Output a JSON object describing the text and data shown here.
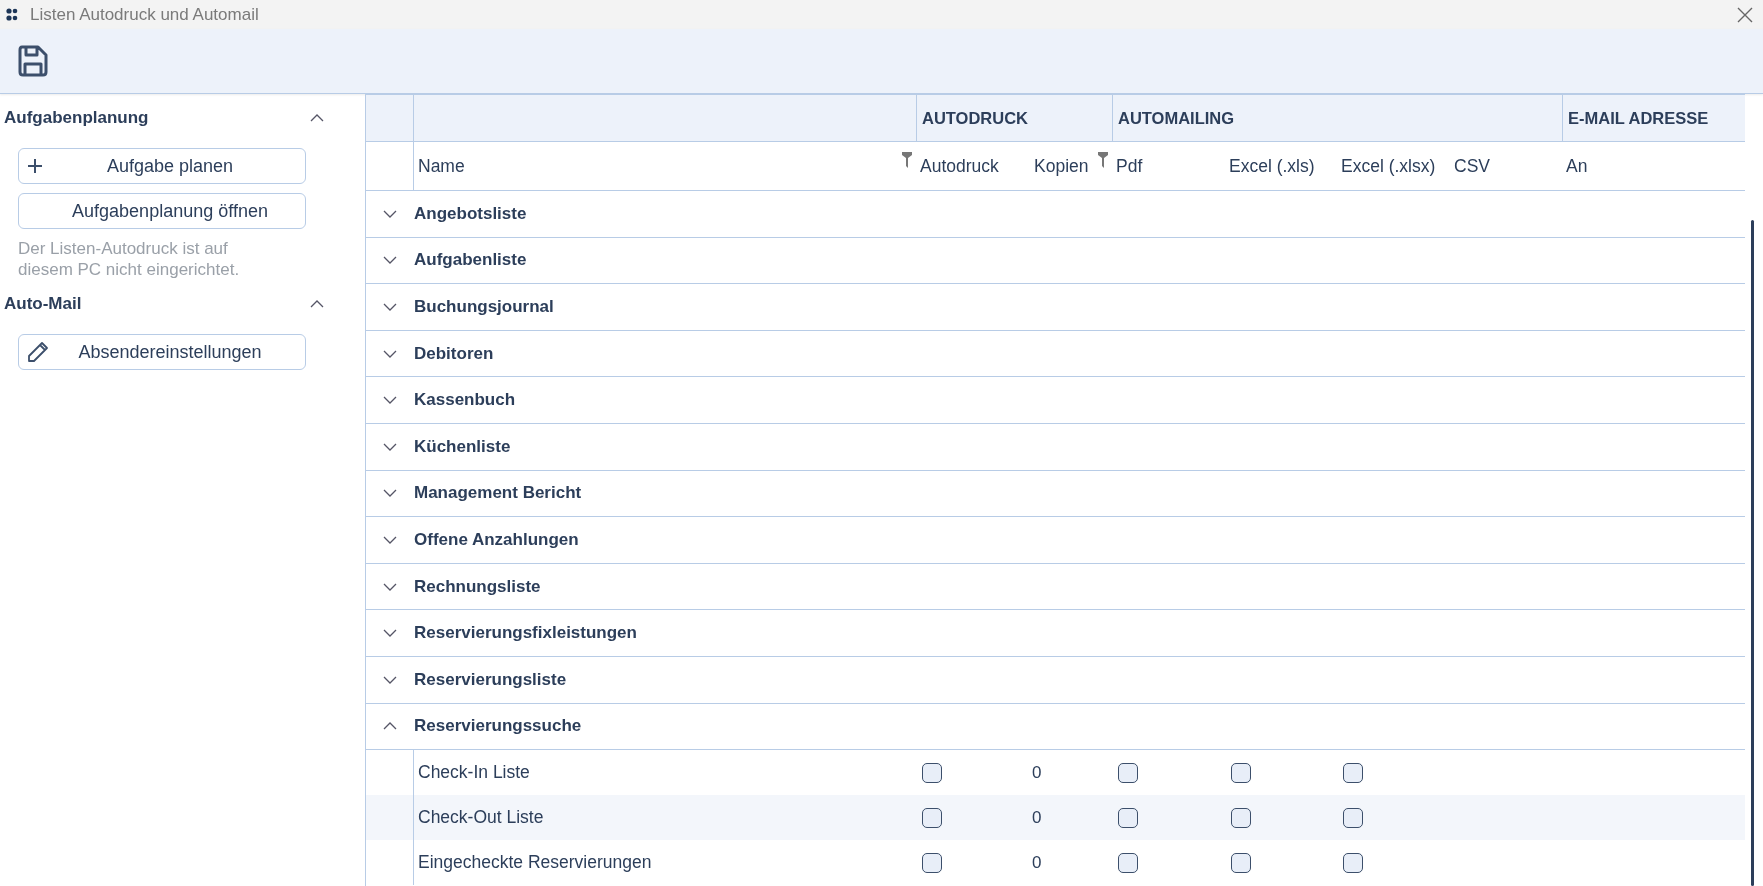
{
  "window": {
    "title": "Listen Autodruck und Automail"
  },
  "sidebar": {
    "sections": [
      {
        "title": "Aufgabenplanung",
        "expanded": true,
        "buttons": [
          {
            "label": "Aufgabe planen",
            "kind": "plus"
          },
          {
            "label": "Aufgabenplanung öffnen",
            "kind": "plain"
          }
        ],
        "note": "Der Listen-Autodruck ist auf diesem PC nicht eingerichtet."
      },
      {
        "title": "Auto-Mail",
        "expanded": true,
        "buttons": [
          {
            "label": "Absendereinstellungen",
            "kind": "pencil"
          }
        ]
      }
    ]
  },
  "table": {
    "column_groups": [
      {
        "columns": [
          {
            "label": "Name",
            "filter": true
          }
        ]
      },
      {
        "label": "AUTODRUCK",
        "columns": [
          {
            "label": "Autodruck",
            "filter": false
          },
          {
            "label": "Kopien",
            "filter": true
          }
        ]
      },
      {
        "label": "AUTOMAILING",
        "columns": [
          {
            "label": "Pdf",
            "filter": false
          },
          {
            "label": "Excel (.xls)",
            "filter": false
          },
          {
            "label": "Excel (.xlsx)",
            "filter": false
          },
          {
            "label": "CSV",
            "filter": false
          }
        ]
      },
      {
        "label": "E-MAIL ADRESSE",
        "columns": [
          {
            "label": "An",
            "filter": false
          }
        ]
      }
    ],
    "groups": [
      {
        "name": "Angebotsliste",
        "expanded": false
      },
      {
        "name": "Aufgabenliste",
        "expanded": false
      },
      {
        "name": "Buchungsjournal",
        "expanded": false
      },
      {
        "name": "Debitoren",
        "expanded": false
      },
      {
        "name": "Kassenbuch",
        "expanded": false
      },
      {
        "name": "Küchenliste",
        "expanded": false
      },
      {
        "name": "Management Bericht",
        "expanded": false
      },
      {
        "name": "Offene Anzahlungen",
        "expanded": false
      },
      {
        "name": "Rechnungsliste",
        "expanded": false
      },
      {
        "name": "Reservierungsfixleistungen",
        "expanded": false
      },
      {
        "name": "Reservierungsliste",
        "expanded": false
      },
      {
        "name": "Reservierungssuche",
        "expanded": true,
        "children": [
          {
            "name": "Check-In Liste",
            "selected": false,
            "cells": [
              {
                "kind": "checkbox",
                "checked": false
              },
              {
                "kind": "text",
                "text": "0"
              },
              {
                "kind": "checkbox",
                "checked": false
              },
              {
                "kind": "checkbox",
                "checked": false
              },
              {
                "kind": "checkbox",
                "checked": false
              }
            ]
          },
          {
            "name": "Check-Out Liste",
            "selected": true,
            "cells": [
              {
                "kind": "checkbox",
                "checked": false
              },
              {
                "kind": "text",
                "text": "0"
              },
              {
                "kind": "checkbox",
                "checked": false
              },
              {
                "kind": "checkbox",
                "checked": false
              },
              {
                "kind": "checkbox",
                "checked": false
              }
            ]
          },
          {
            "name": "Eingecheckte Reservierungen",
            "selected": false,
            "cells": [
              {
                "kind": "checkbox",
                "checked": false
              },
              {
                "kind": "text",
                "text": "0"
              },
              {
                "kind": "checkbox",
                "checked": false
              },
              {
                "kind": "checkbox",
                "checked": false
              },
              {
                "kind": "checkbox",
                "checked": false
              }
            ]
          }
        ]
      }
    ]
  }
}
